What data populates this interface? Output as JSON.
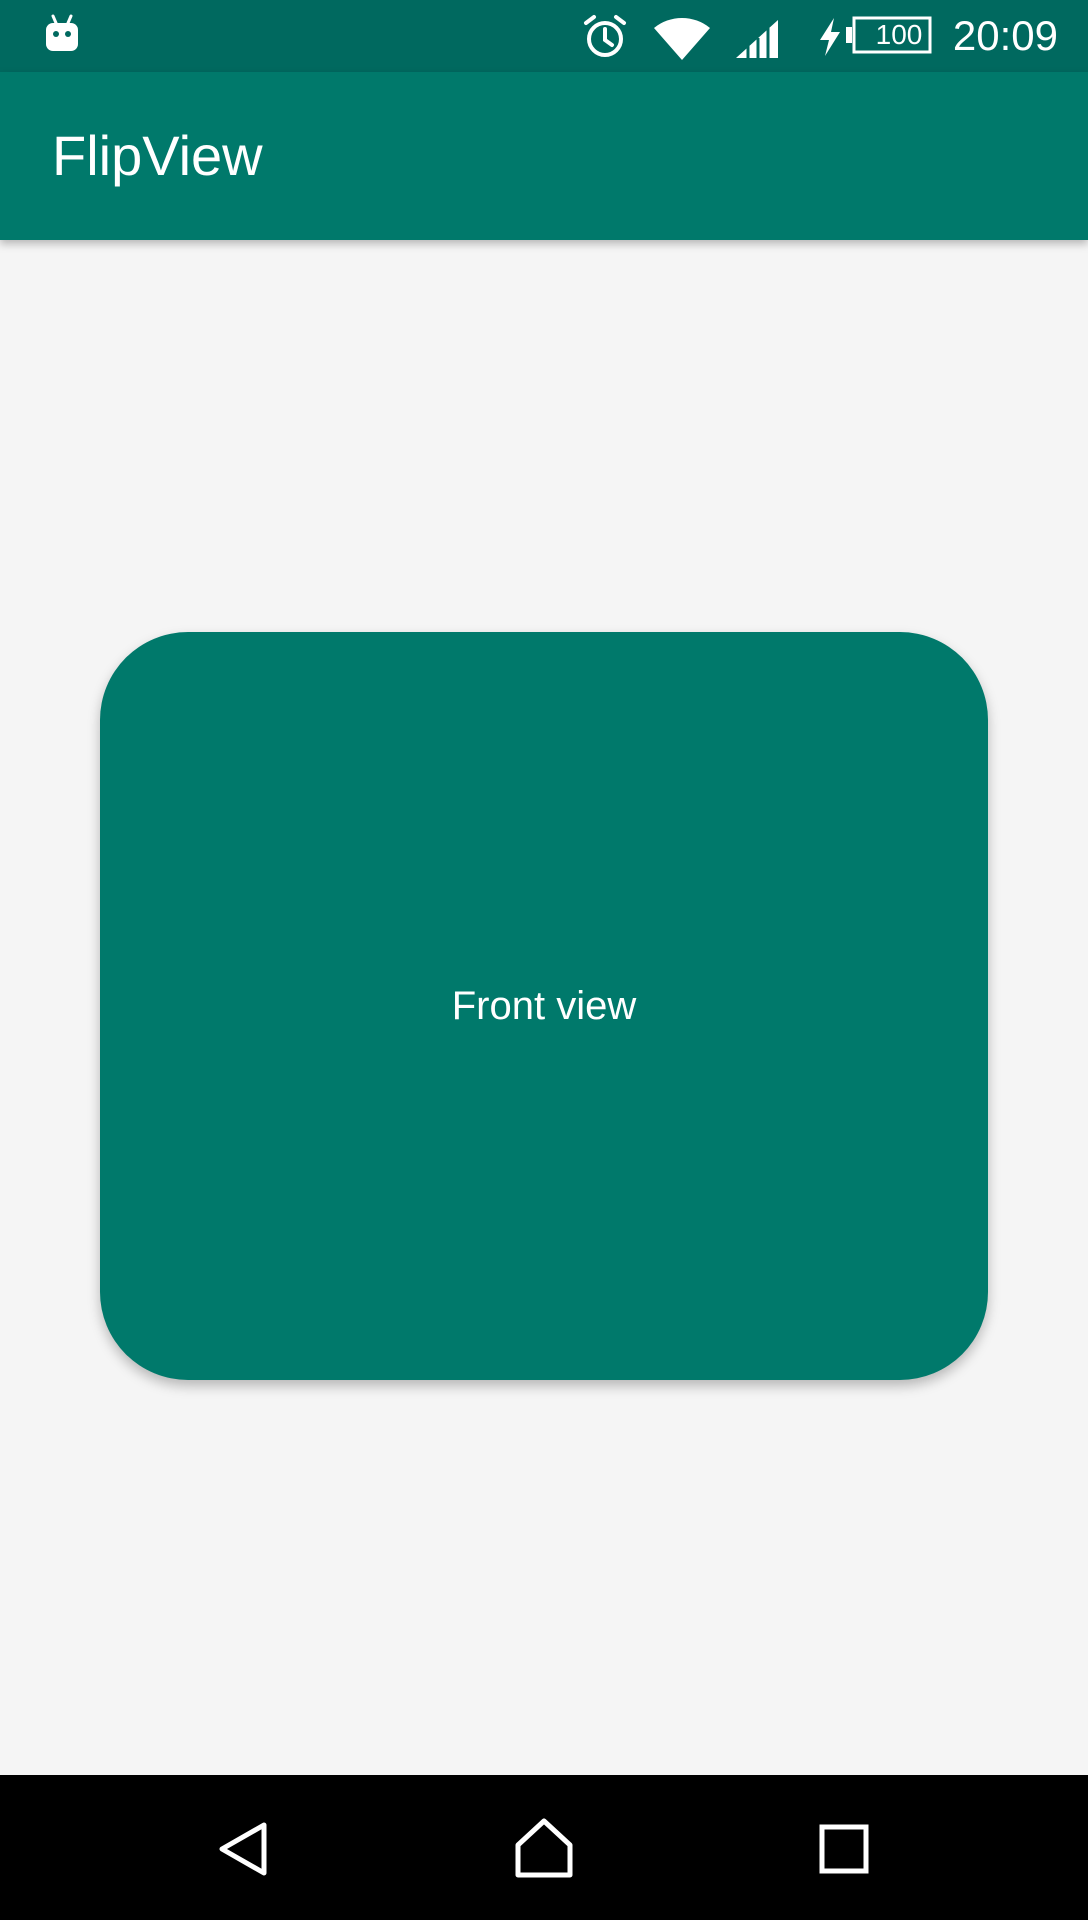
{
  "status_bar": {
    "time": "20:09",
    "battery_level": "100",
    "icons": [
      "android-notification-icon",
      "alarm-icon",
      "wifi-icon",
      "cell-signal-icon",
      "charging-icon",
      "battery-icon"
    ]
  },
  "app_bar": {
    "title": "FlipView"
  },
  "flip_card": {
    "label": "Front view"
  },
  "nav_bar": {
    "icons": [
      "back-icon",
      "home-icon",
      "recents-icon"
    ]
  },
  "colors": {
    "primary": "#00796b",
    "primary_dark": "#00695f",
    "background": "#f5f5f5",
    "nav_bar": "#000000",
    "on_primary": "#ffffff"
  }
}
